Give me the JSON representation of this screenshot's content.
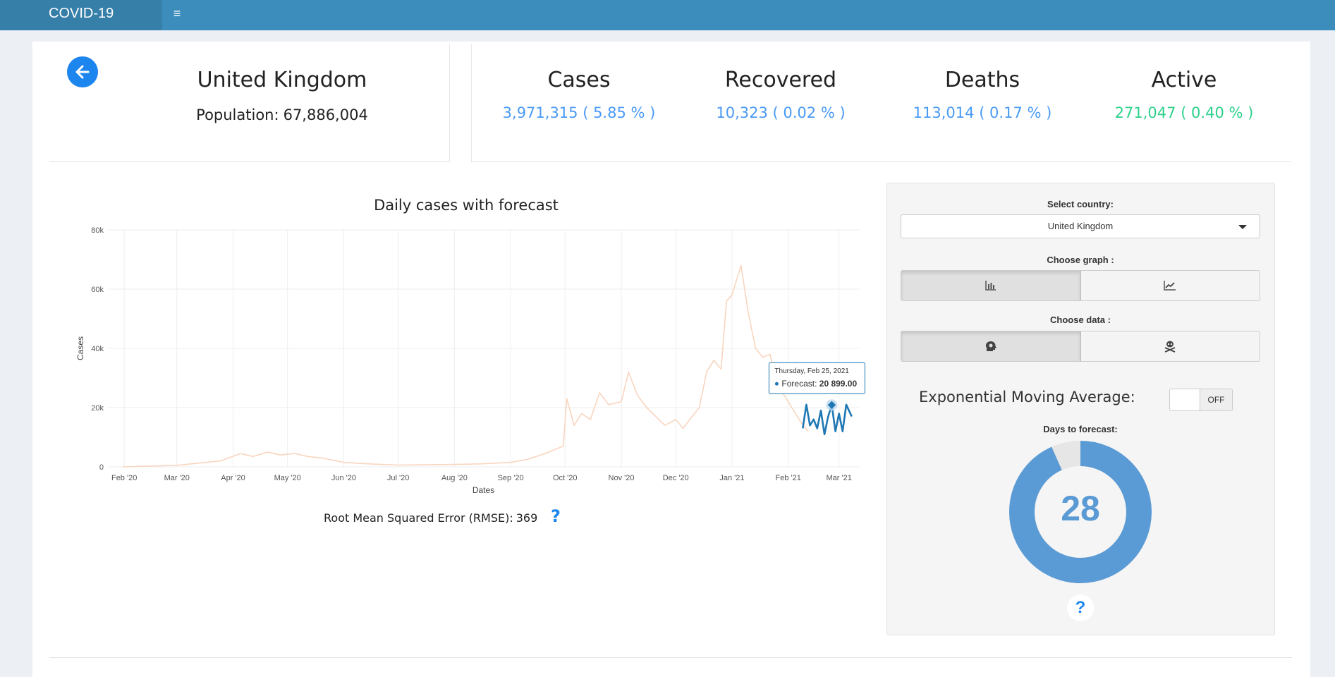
{
  "app": {
    "title": "COVID-19",
    "menu_icon": "hamburger-icon"
  },
  "header": {
    "country": "United Kingdom",
    "population_label": "Population:",
    "population_value": "67,886,004"
  },
  "stats": [
    {
      "title": "Cases",
      "value": "3,971,315 ( 5.85 % )",
      "color": "#4a9af5"
    },
    {
      "title": "Recovered",
      "value": "10,323 ( 0.02 % )",
      "color": "#4a9af5"
    },
    {
      "title": "Deaths",
      "value": "113,014 ( 0.17 % )",
      "color": "#4a9af5"
    },
    {
      "title": "Active",
      "value": "271,047 ( 0.40 % )",
      "color": "#2ed18c"
    }
  ],
  "chart_data": {
    "type": "line",
    "title": "Daily cases with forecast",
    "xlabel": "Dates",
    "ylabel": "Cases",
    "ylim": [
      0,
      80000
    ],
    "yticks": [
      "0",
      "20k",
      "40k",
      "60k",
      "80k"
    ],
    "xticks": [
      "Feb '20",
      "Mar '20",
      "Apr '20",
      "May '20",
      "Jun '20",
      "Jul '20",
      "Aug '20",
      "Sep '20",
      "Oct '20",
      "Nov '20",
      "Dec '20",
      "Jan '21",
      "Feb '21",
      "Mar '21"
    ],
    "grid": true,
    "series": [
      {
        "color": "#f9d5bf",
        "x": [
          "2020-01-31",
          "2020-03-01",
          "2020-03-25",
          "2020-04-05",
          "2020-04-12",
          "2020-04-20",
          "2020-04-27",
          "2020-05-05",
          "2020-05-12",
          "2020-05-20",
          "2020-06-01",
          "2020-06-15",
          "2020-07-01",
          "2020-07-15",
          "2020-08-01",
          "2020-08-15",
          "2020-09-01",
          "2020-09-10",
          "2020-09-20",
          "2020-09-30",
          "2020-10-02",
          "2020-10-06",
          "2020-10-10",
          "2020-10-15",
          "2020-10-20",
          "2020-10-25",
          "2020-11-01",
          "2020-11-05",
          "2020-11-10",
          "2020-11-15",
          "2020-11-20",
          "2020-11-25",
          "2020-12-01",
          "2020-12-05",
          "2020-12-10",
          "2020-12-14",
          "2020-12-18",
          "2020-12-22",
          "2020-12-26",
          "2020-12-29",
          "2021-01-01",
          "2021-01-04",
          "2021-01-06",
          "2021-01-08",
          "2021-01-10",
          "2021-01-14",
          "2021-01-18",
          "2021-01-22",
          "2021-01-26",
          "2021-01-30",
          "2021-02-03",
          "2021-02-08",
          "2021-02-12"
        ],
        "y": [
          0,
          500,
          2000,
          4500,
          3500,
          5000,
          4000,
          4500,
          3500,
          3000,
          1500,
          1000,
          600,
          700,
          800,
          1000,
          1500,
          2500,
          4500,
          7000,
          23000,
          14000,
          18000,
          16000,
          25000,
          21000,
          22000,
          32000,
          24000,
          20000,
          17000,
          14000,
          16000,
          13000,
          17000,
          20000,
          32000,
          36000,
          33000,
          56000,
          58000,
          64000,
          68000,
          60000,
          52000,
          40000,
          37000,
          38000,
          27000,
          24000,
          20000,
          15000,
          12000
        ]
      },
      {
        "name": "Forecast",
        "color": "#1f77b4",
        "x": [
          "2021-02-09",
          "2021-02-11",
          "2021-02-13",
          "2021-02-15",
          "2021-02-17",
          "2021-02-19",
          "2021-02-21",
          "2021-02-23",
          "2021-02-25",
          "2021-02-27",
          "2021-03-01",
          "2021-03-03",
          "2021-03-05",
          "2021-03-08"
        ],
        "y": [
          13000,
          21000,
          14000,
          16000,
          13000,
          19000,
          11000,
          17000,
          20899,
          12000,
          18000,
          12000,
          21000,
          17000
        ]
      }
    ],
    "tooltip": {
      "date": "Thursday, Feb 25, 2021",
      "label": "Forecast:",
      "value": "20 899.00"
    },
    "rmse_label": "Root Mean Squared Error (RMSE):",
    "rmse_value": "369"
  },
  "panel": {
    "select_country_label": "Select country:",
    "selected_country": "United Kingdom",
    "choose_graph_label": "Choose graph :",
    "graph_options": [
      {
        "icon": "bar-chart-icon",
        "selected": true
      },
      {
        "icon": "line-chart-icon",
        "selected": false
      }
    ],
    "choose_data_label": "Choose data :",
    "data_options": [
      {
        "icon": "head-virus-icon",
        "selected": true
      },
      {
        "icon": "skull-crossbones-icon",
        "selected": false
      }
    ],
    "ema_label": "Exponential Moving Average:",
    "ema_toggle": "OFF",
    "days_label": "Days to forecast:",
    "days_value": 28,
    "days_max": 30,
    "gauge_color": "#5b9bd5",
    "help": "?"
  },
  "colors": {
    "topbar": "#3c8dbc",
    "brand": "#367fa9",
    "accent": "#1d86ee"
  }
}
